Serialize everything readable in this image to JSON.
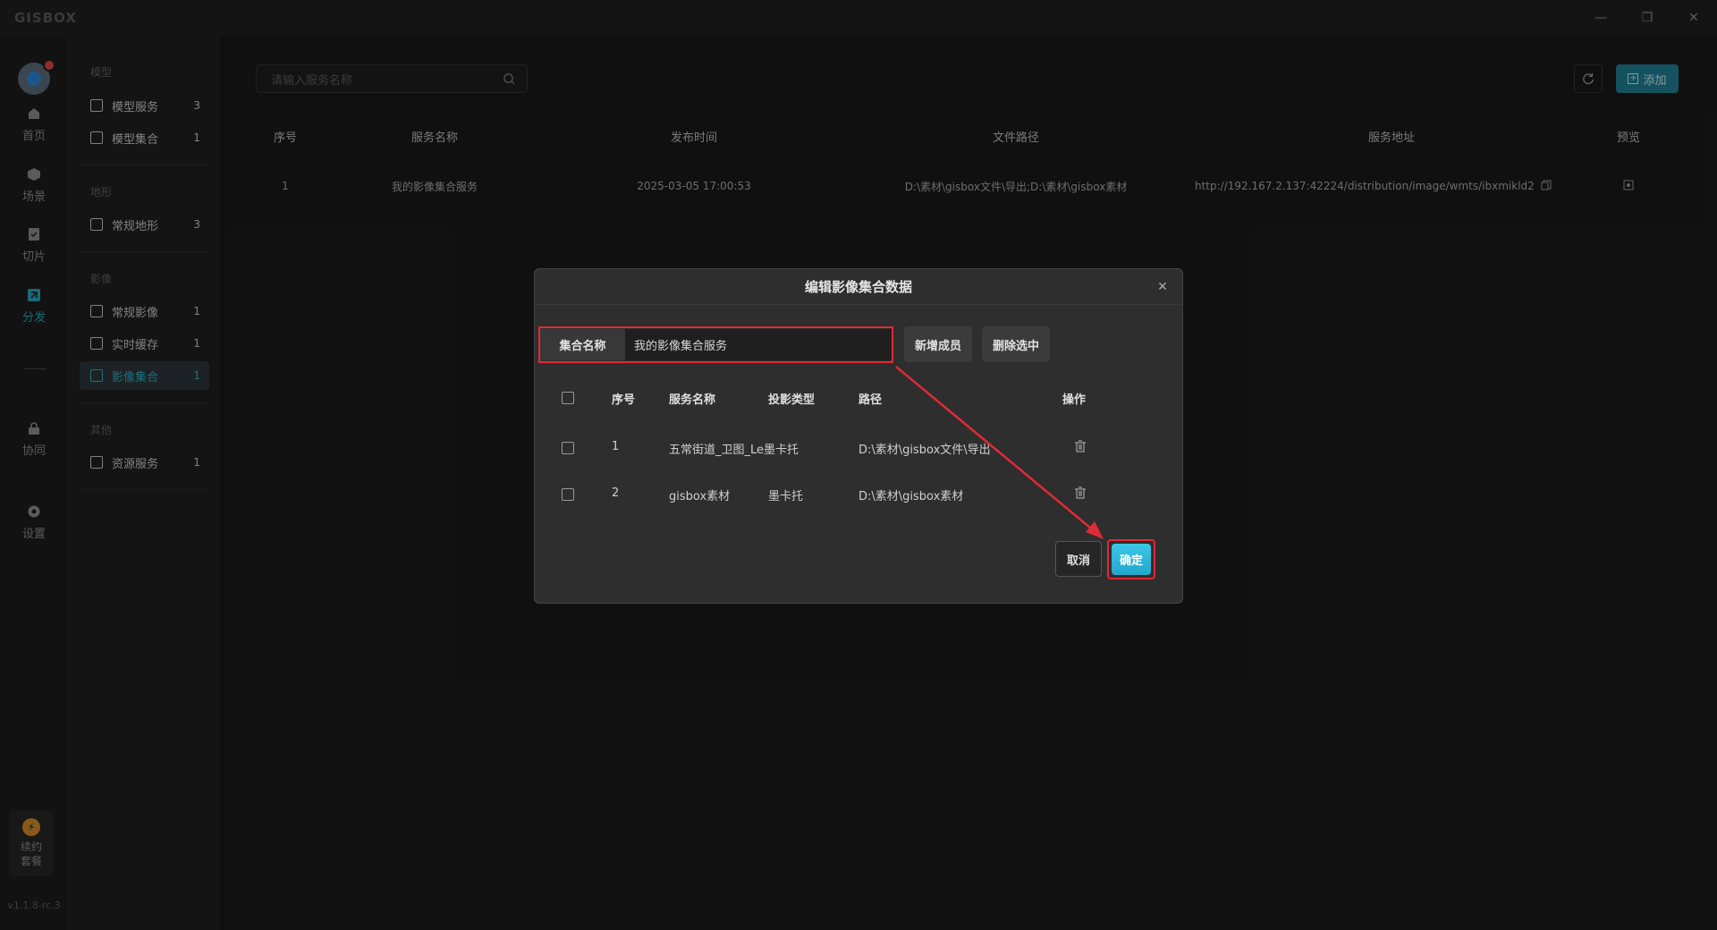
{
  "app": {
    "logo": "GISBOX"
  },
  "window": {
    "minimize": "—",
    "restore": "❐",
    "close": "✕"
  },
  "rail": {
    "items": [
      {
        "label": "首页",
        "icon": "home-icon"
      },
      {
        "label": "场景",
        "icon": "cube-icon"
      },
      {
        "label": "切片",
        "icon": "slice-icon"
      },
      {
        "label": "分发",
        "icon": "distribute-icon",
        "active": true
      },
      {
        "label": "协同",
        "icon": "lock-icon"
      },
      {
        "label": "设置",
        "icon": "gear-icon"
      }
    ],
    "renew_line1": "续约",
    "renew_line2": "套餐",
    "version": "v1.1.8-rc.3"
  },
  "catpanel": {
    "groups": [
      {
        "title": "模型",
        "items": [
          {
            "label": "模型服务",
            "count": "3"
          },
          {
            "label": "模型集合",
            "count": "1"
          }
        ]
      },
      {
        "title": "地形",
        "items": [
          {
            "label": "常规地形",
            "count": "3"
          }
        ]
      },
      {
        "title": "影像",
        "items": [
          {
            "label": "常规影像",
            "count": "1"
          },
          {
            "label": "实时缓存",
            "count": "1"
          },
          {
            "label": "影像集合",
            "count": "1",
            "active": true
          }
        ]
      },
      {
        "title": "其他",
        "items": [
          {
            "label": "资源服务",
            "count": "1"
          }
        ]
      }
    ]
  },
  "main": {
    "search_placeholder": "请输入服务名称",
    "add_label": "添加",
    "table": {
      "headers": [
        "序号",
        "服务名称",
        "发布时间",
        "文件路径",
        "服务地址",
        "预览"
      ],
      "rows": [
        [
          "1",
          "我的影像集合服务",
          "2025-03-05 17:00:53",
          "D:\\素材\\gisbox文件\\导出;D:\\素材\\gisbox素材",
          "http://192.167.2.137:42224/distribution/image/wmts/ibxmikld2..."
        ]
      ]
    }
  },
  "dialog": {
    "title": "编辑影像集合数据",
    "name_label": "集合名称",
    "name_value": "我的影像集合服务",
    "add_member": "新增成员",
    "delete_selected": "删除选中",
    "headers": [
      "序号",
      "服务名称",
      "投影类型",
      "路径",
      "操作"
    ],
    "rows": [
      [
        "1",
        "五常街道_卫图_Le墨卡托",
        "",
        "D:\\素材\\gisbox文件\\导出"
      ],
      [
        "2",
        "gisbox素材",
        "墨卡托",
        "D:\\素材\\gisbox素材"
      ]
    ],
    "cancel": "取消",
    "confirm": "确定"
  },
  "colors": {
    "accent": "#2aa3b8",
    "highlight": "#e02a35",
    "confirm": "#2bb4d6"
  }
}
